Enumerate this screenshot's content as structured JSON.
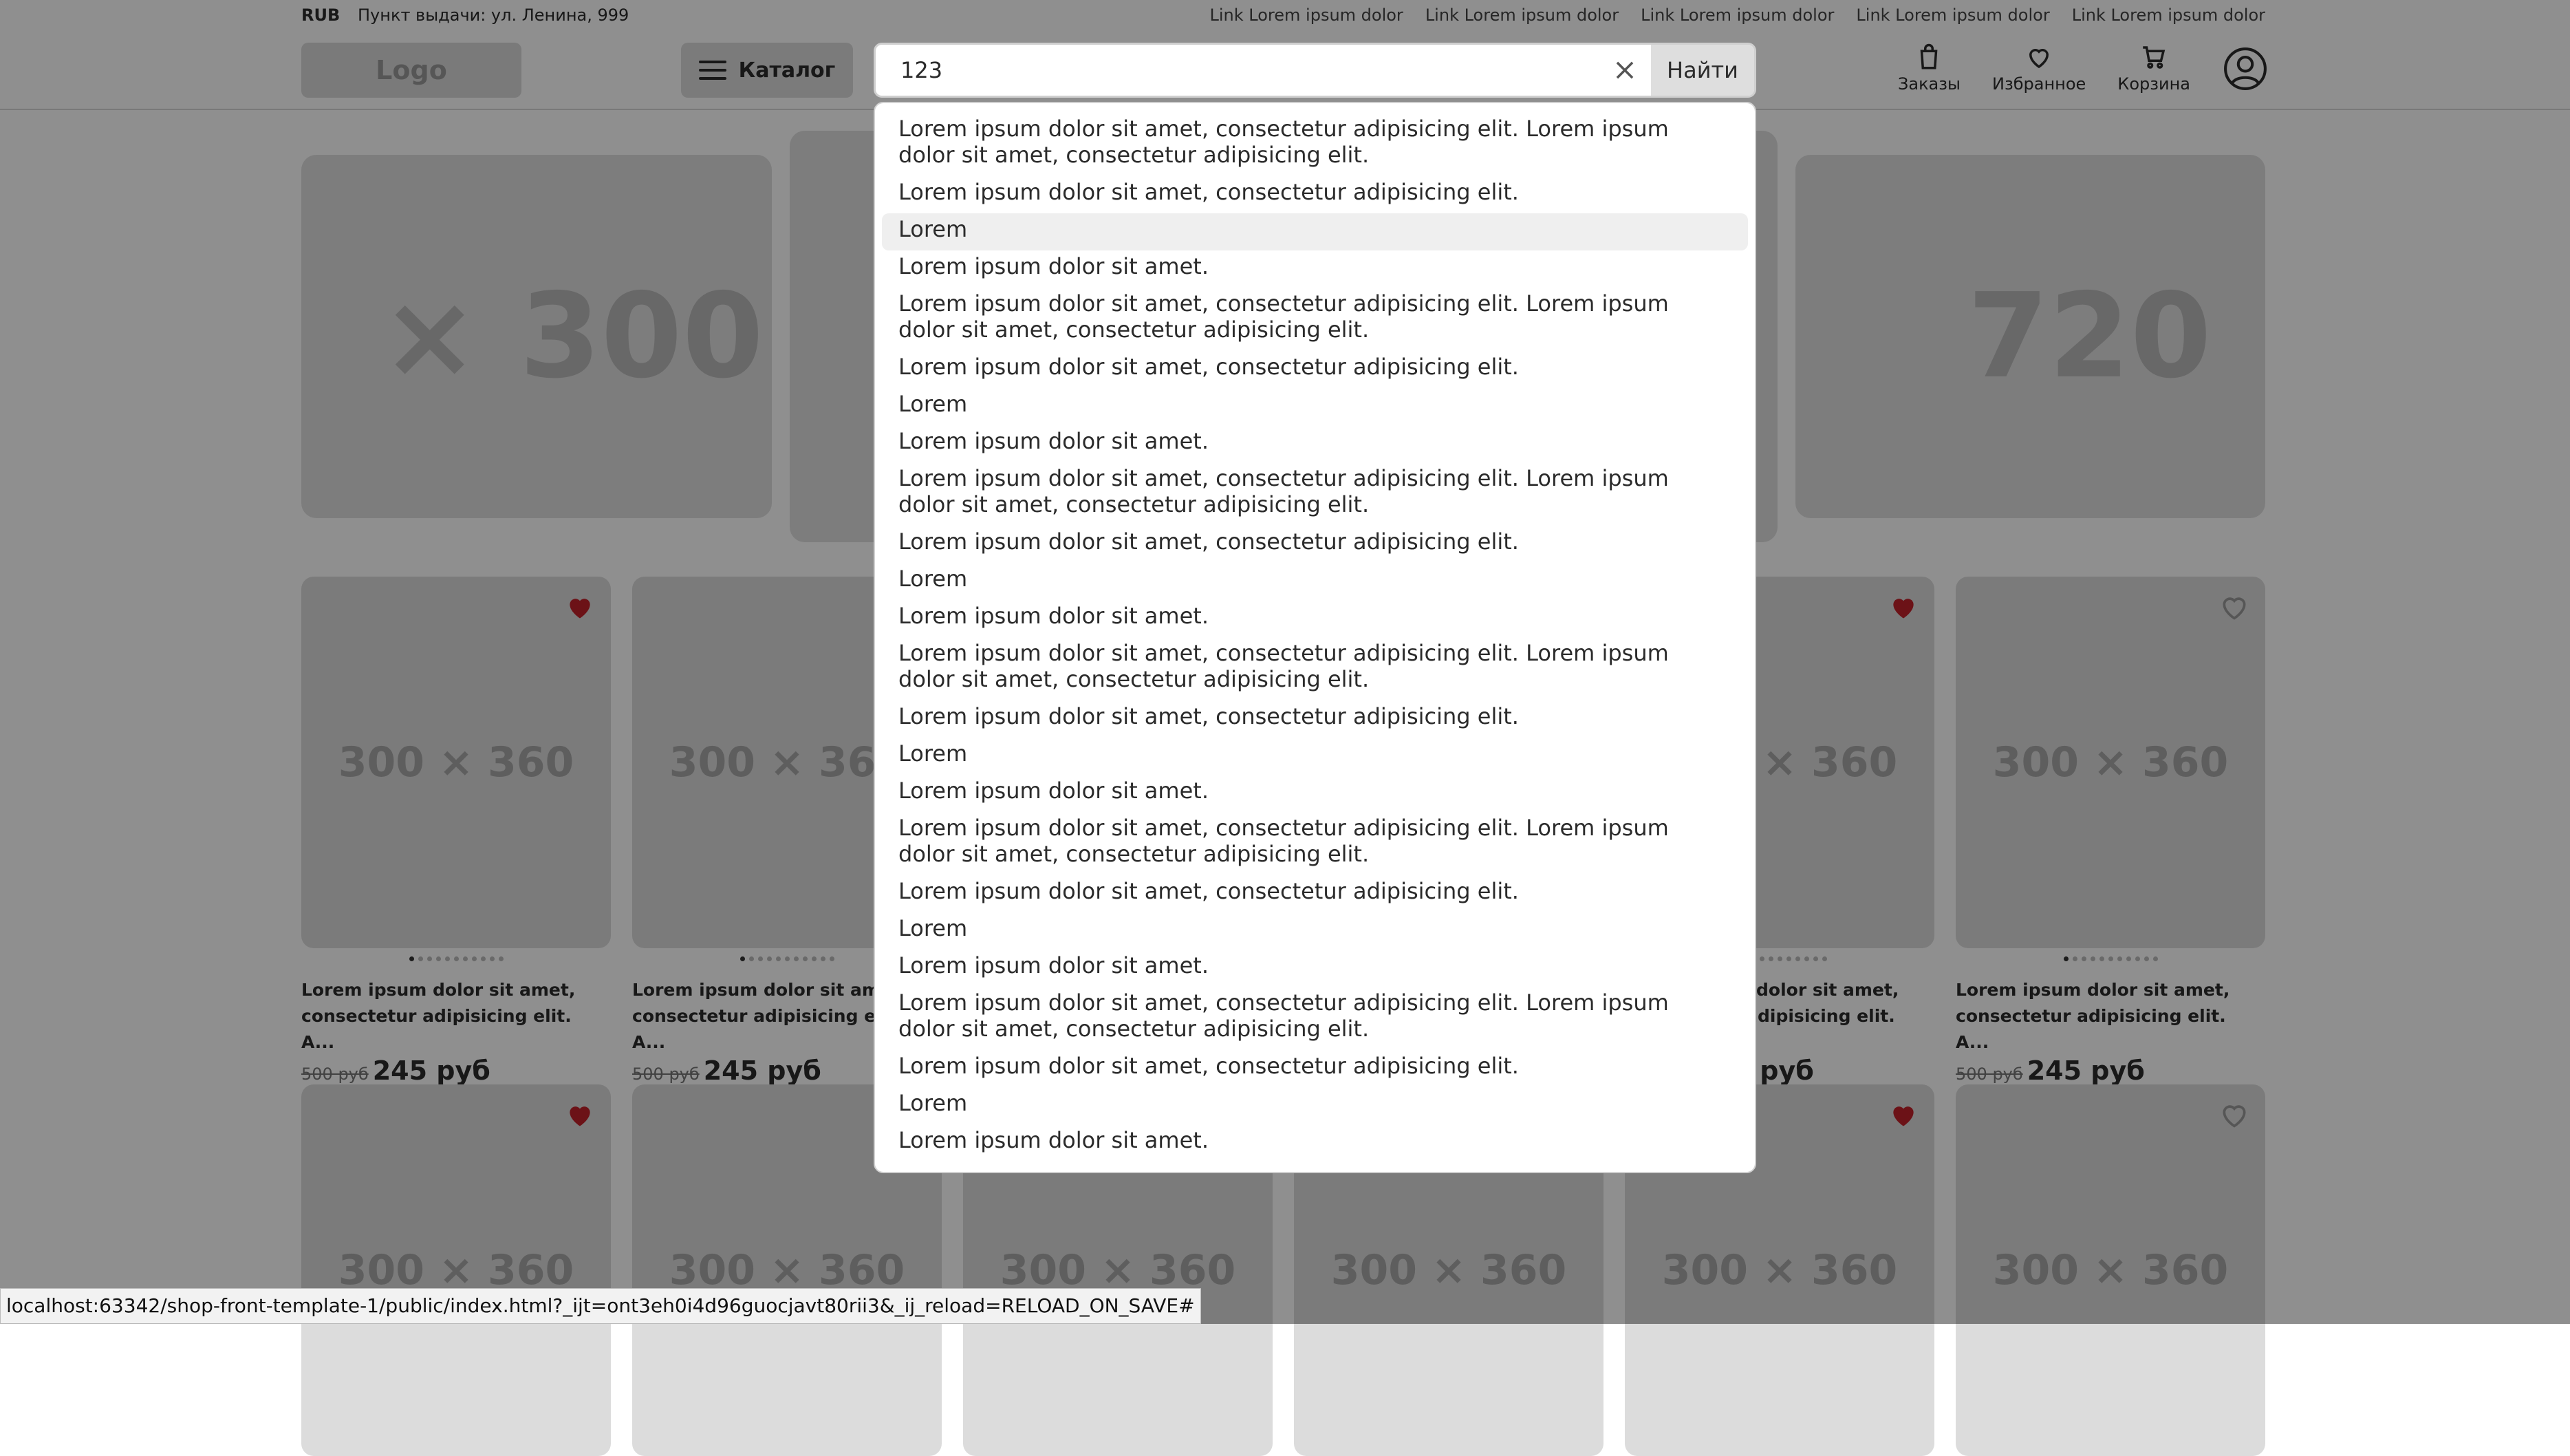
{
  "topbar": {
    "currency": "RUB",
    "pickup": "Пункт выдачи: ул. Ленина, 999",
    "links": [
      "Link Lorem ipsum dolor",
      "Link Lorem ipsum dolor",
      "Link Lorem ipsum dolor",
      "Link Lorem ipsum dolor",
      "Link Lorem ipsum dolor"
    ]
  },
  "header": {
    "logo": "Logo",
    "catalog_label": "Каталог",
    "orders_label": "Заказы",
    "favorites_label": "Избранное",
    "cart_label": "Корзина"
  },
  "search": {
    "value": "123",
    "button_label": "Найти",
    "suggestions": [
      "Lorem ipsum dolor sit amet, consectetur adipisicing elit. Lorem ipsum dolor sit amet, consectetur adipisicing elit.",
      "Lorem ipsum dolor sit amet, consectetur adipisicing elit.",
      "Lorem",
      "Lorem ipsum dolor sit amet.",
      "Lorem ipsum dolor sit amet, consectetur adipisicing elit. Lorem ipsum dolor sit amet, consectetur adipisicing elit.",
      "Lorem ipsum dolor sit amet, consectetur adipisicing elit.",
      "Lorem",
      "Lorem ipsum dolor sit amet.",
      "Lorem ipsum dolor sit amet, consectetur adipisicing elit. Lorem ipsum dolor sit amet, consectetur adipisicing elit.",
      "Lorem ipsum dolor sit amet, consectetur adipisicing elit.",
      "Lorem",
      "Lorem ipsum dolor sit amet.",
      "Lorem ipsum dolor sit amet, consectetur adipisicing elit. Lorem ipsum dolor sit amet, consectetur adipisicing elit.",
      "Lorem ipsum dolor sit amet, consectetur adipisicing elit.",
      "Lorem",
      "Lorem ipsum dolor sit amet.",
      "Lorem ipsum dolor sit amet, consectetur adipisicing elit. Lorem ipsum dolor sit amet, consectetur adipisicing elit.",
      "Lorem ipsum dolor sit amet, consectetur adipisicing elit.",
      "Lorem",
      "Lorem ipsum dolor sit amet.",
      "Lorem ipsum dolor sit amet, consectetur adipisicing elit. Lorem ipsum dolor sit amet, consectetur adipisicing elit.",
      "Lorem ipsum dolor sit amet, consectetur adipisicing elit.",
      "Lorem",
      "Lorem ipsum dolor sit amet."
    ],
    "highlighted_index": 2
  },
  "banners": {
    "left_text": "× 300",
    "right_text": "720 ×"
  },
  "products": {
    "placeholder": "300 × 360",
    "name": "Lorem ipsum dolor sit amet, consectetur adipisicing elit. A...",
    "old_price": "500 руб",
    "price": "245 руб",
    "partial_price": "уб",
    "partial_placeholder": "× 360",
    "partial_name": "Lorem ipsum dolor sit amet, consectetur adipisicing elit. A...",
    "heart_colors": {
      "filled": "#c0202a",
      "empty": "#9a9a9a"
    }
  },
  "status_bar": {
    "url": "localhost:63342/shop-front-template-1/public/index.html?_ijt=ont3eh0i4d96guocjavt80rii3&_ij_reload=RELOAD_ON_SAVE#"
  }
}
